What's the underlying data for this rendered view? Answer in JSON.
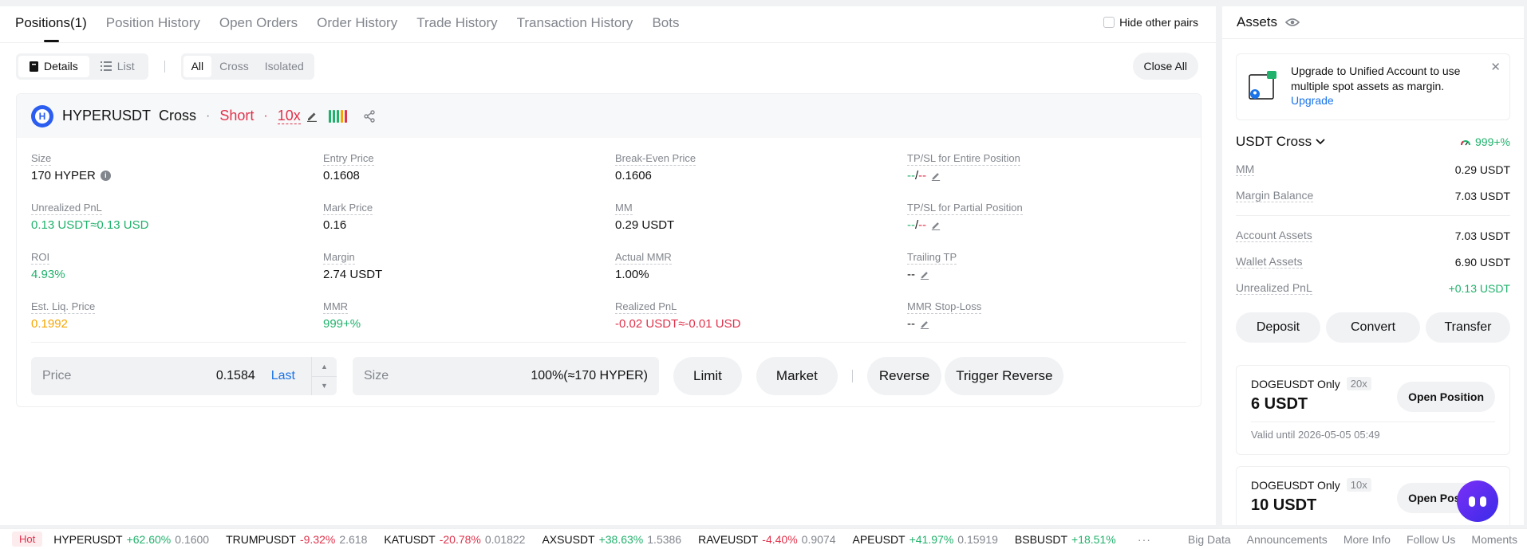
{
  "tabs": [
    {
      "label": "Positions(1)",
      "active": true
    },
    {
      "label": "Position History"
    },
    {
      "label": "Open Orders"
    },
    {
      "label": "Order History"
    },
    {
      "label": "Trade History"
    },
    {
      "label": "Transaction History"
    },
    {
      "label": "Bots"
    }
  ],
  "hide_other_pairs": {
    "label": "Hide other pairs",
    "checked": false
  },
  "view_toggle": {
    "details": "Details",
    "list": "List"
  },
  "margin_filter": {
    "all": "All",
    "cross": "Cross",
    "isolated": "Isolated"
  },
  "close_all_label": "Close All",
  "position": {
    "coin_letter": "H",
    "symbol": "HYPERUSDT",
    "mode": "Cross",
    "side": "Short",
    "leverage": "10x",
    "fields": {
      "size": {
        "label": "Size",
        "value": "170 HYPER"
      },
      "entry_price": {
        "label": "Entry Price",
        "value": "0.1608"
      },
      "break_even": {
        "label": "Break-Even Price",
        "value": "0.1606"
      },
      "tpsl_entire": {
        "label": "TP/SL for Entire Position",
        "tp": "--",
        "sep": "/",
        "sl": "--"
      },
      "unrealized_pnl": {
        "label": "Unrealized PnL",
        "value": "0.13 USDT≈0.13 USD"
      },
      "mark_price": {
        "label": "Mark Price",
        "value": "0.16"
      },
      "mm": {
        "label": "MM",
        "value": "0.29 USDT"
      },
      "tpsl_partial": {
        "label": "TP/SL for Partial Position",
        "tp": "--",
        "sep": "/",
        "sl": "--"
      },
      "roi": {
        "label": "ROI",
        "value": "4.93%"
      },
      "margin": {
        "label": "Margin",
        "value": "2.74 USDT"
      },
      "actual_mmr": {
        "label": "Actual MMR",
        "value": "1.00%"
      },
      "trailing_tp": {
        "label": "Trailing TP",
        "value": "--"
      },
      "est_liq": {
        "label": "Est. Liq. Price",
        "value": "0.1992"
      },
      "mmr": {
        "label": "MMR",
        "value": "999+%"
      },
      "realized_pnl": {
        "label": "Realized PnL",
        "value": "-0.02 USDT≈-0.01 USD"
      },
      "mmr_stop_loss": {
        "label": "MMR Stop-Loss",
        "value": "--"
      }
    },
    "order": {
      "price_placeholder": "Price",
      "price_value": "0.1584",
      "last_label": "Last",
      "size_placeholder": "Size",
      "size_value": "100%(≈170 HYPER)",
      "limit": "Limit",
      "market": "Market",
      "reverse": "Reverse",
      "trigger_reverse": "Trigger Reverse"
    }
  },
  "assets": {
    "title": "Assets",
    "upgrade_text": "Upgrade to Unified Account to use multiple spot assets as margin.",
    "upgrade_link": "Upgrade",
    "cross_title": "USDT Cross",
    "cross_value": "999+%",
    "rows_a": [
      {
        "k": "MM",
        "v": "0.29 USDT"
      },
      {
        "k": "Margin Balance",
        "v": "7.03 USDT"
      }
    ],
    "rows_b": [
      {
        "k": "Account Assets",
        "v": "7.03 USDT"
      },
      {
        "k": "Wallet Assets",
        "v": "6.90 USDT"
      },
      {
        "k": "Unrealized PnL",
        "v": "+0.13 USDT"
      }
    ],
    "buttons": {
      "deposit": "Deposit",
      "convert": "Convert",
      "transfer": "Transfer"
    },
    "promos": [
      {
        "title": "DOGEUSDT Only",
        "tag": "20x",
        "amount": "6 USDT",
        "valid": "Valid until 2026-05-05 05:49",
        "button": "Open Position"
      },
      {
        "title": "DOGEUSDT Only",
        "tag": "10x",
        "amount": "10 USDT",
        "button": "Open Position"
      }
    ]
  },
  "ticker": {
    "hot": "Hot",
    "items": [
      {
        "s": "HYPERUSDT",
        "c": "+62.60%",
        "p": "0.1600",
        "up": true
      },
      {
        "s": "TRUMPUSDT",
        "c": "-9.32%",
        "p": "2.618",
        "up": false
      },
      {
        "s": "KATUSDT",
        "c": "-20.78%",
        "p": "0.01822",
        "up": false
      },
      {
        "s": "AXSUSDT",
        "c": "+38.63%",
        "p": "1.5386",
        "up": true
      },
      {
        "s": "RAVEUSDT",
        "c": "-4.40%",
        "p": "0.9074",
        "up": false
      },
      {
        "s": "APEUSDT",
        "c": "+41.97%",
        "p": "0.15919",
        "up": true
      },
      {
        "s": "BSBUSDT",
        "c": "+18.51%",
        "p": "",
        "up": true
      }
    ],
    "more": "···",
    "links": [
      "Big Data",
      "Announcements",
      "More Info",
      "Follow Us",
      "Moments"
    ]
  },
  "colors": {
    "up": "#20b26c",
    "down": "#e0324b",
    "accent": "#1a73e8",
    "liq": "#f7a600"
  }
}
